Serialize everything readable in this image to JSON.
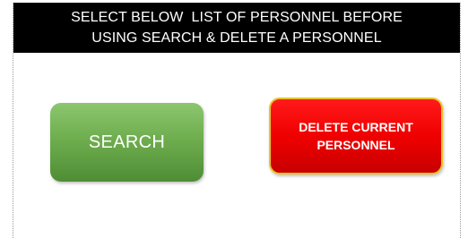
{
  "header": {
    "line1": "SELECT BELOW  LIST OF PERSONNEL BEFORE",
    "line2": "USING SEARCH & DELETE A PERSONNEL"
  },
  "buttons": {
    "search_label": "SEARCH",
    "delete_line1": "DELETE CURRENT",
    "delete_line2": "PERSONNEL"
  },
  "colors": {
    "header_bg": "#000000",
    "search_green": "#6fae4f",
    "delete_red": "#f00000",
    "delete_border": "#e8c22a"
  }
}
